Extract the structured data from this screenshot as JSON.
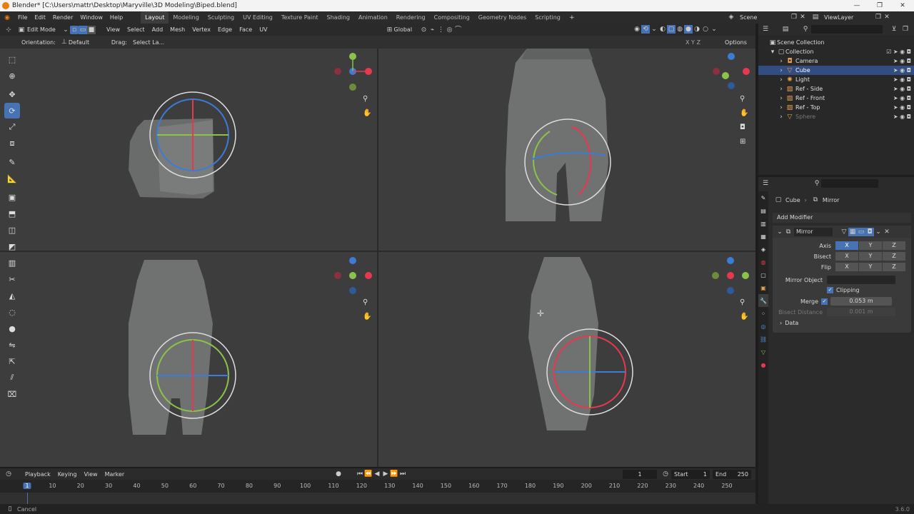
{
  "window": {
    "title": "Blender* [C:\\Users\\mattr\\Desktop\\Maryville\\3D Modeling\\Biped.blend]",
    "minimize": "—",
    "maximize": "❐",
    "close": "✕"
  },
  "menu": [
    "File",
    "Edit",
    "Render",
    "Window",
    "Help"
  ],
  "workspaces": [
    "Layout",
    "Modeling",
    "Sculpting",
    "UV Editing",
    "Texture Paint",
    "Shading",
    "Animation",
    "Rendering",
    "Compositing",
    "Geometry Nodes",
    "Scripting"
  ],
  "active_workspace": "Layout",
  "scene_name": "Scene",
  "view_layer": "ViewLayer",
  "viewport_header": {
    "mode": "Edit Mode",
    "menus": [
      "View",
      "Select",
      "Add",
      "Mesh",
      "Vertex",
      "Edge",
      "Face",
      "UV"
    ],
    "transform_orientation": "Global",
    "options": "Options"
  },
  "tool_settings": {
    "orientation_label": "Orientation:",
    "orientation_value": "Default",
    "drag_label": "Drag:",
    "drag_value": "Select La..."
  },
  "viewport_axes_label": "X Y Z",
  "toolbar_icons": [
    "select-box",
    "cursor",
    "move",
    "rotate",
    "scale",
    "transform",
    "annotate",
    "measure",
    "add-cube",
    "extrude",
    "inset",
    "bevel",
    "loop-cut",
    "knife",
    "poly-build",
    "spin",
    "smooth",
    "edge-slide",
    "shrink-fatten",
    "shear",
    "rip"
  ],
  "outliner": {
    "root": "Scene Collection",
    "collection": "Collection",
    "items": [
      {
        "name": "Camera",
        "color": "#e0e0e0"
      },
      {
        "name": "Cube",
        "color": "#ffffff",
        "selected": true
      },
      {
        "name": "Light",
        "color": "#e0e0e0"
      },
      {
        "name": "Ref - Side",
        "color": "#e0e0e0"
      },
      {
        "name": "Ref - Front",
        "color": "#e0e0e0"
      },
      {
        "name": "Ref - Top",
        "color": "#e0e0e0"
      },
      {
        "name": "Sphere",
        "color": "#777777"
      }
    ]
  },
  "properties": {
    "breadcrumb_object": "Cube",
    "breadcrumb_modifier": "Mirror",
    "add_modifier": "Add Modifier",
    "modifier_name": "Mirror",
    "axis_label": "Axis",
    "bisect_label": "Bisect",
    "flip_label": "Flip",
    "axes": [
      "X",
      "Y",
      "Z"
    ],
    "mirror_object_label": "Mirror Object",
    "clipping_label": "Clipping",
    "merge_label": "Merge",
    "merge_value": "0.053 m",
    "bisect_distance_label": "Bisect Distance",
    "bisect_distance_value": "0.001 m",
    "data_label": "Data"
  },
  "timeline": {
    "menus": [
      "Playback",
      "Keying",
      "View",
      "Marker"
    ],
    "current_frame": "1",
    "start_label": "Start",
    "start": "1",
    "end_label": "End",
    "end": "250",
    "ticks": [
      "1",
      "10",
      "20",
      "30",
      "40",
      "50",
      "60",
      "70",
      "80",
      "90",
      "100",
      "110",
      "120",
      "130",
      "140",
      "150",
      "160",
      "170",
      "180",
      "190",
      "200",
      "210",
      "220",
      "230",
      "240",
      "250"
    ]
  },
  "status": {
    "left": "Cancel",
    "version": "3.6.0"
  },
  "colors": {
    "accent": "#4772b3",
    "axis_x": "#e8384f",
    "axis_y": "#8bc34a",
    "axis_z": "#3c7bd6"
  }
}
